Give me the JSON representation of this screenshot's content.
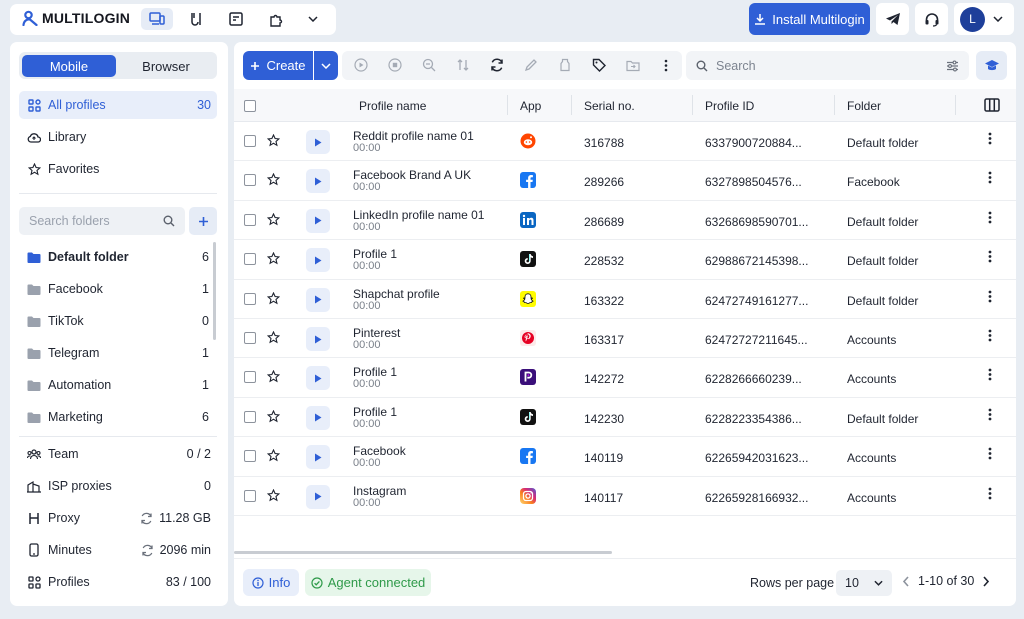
{
  "app": {
    "name": "MULTILOGIN"
  },
  "header": {
    "install_label": "Install Multilogin",
    "avatar_initial": "L",
    "nav_icons": [
      "devices-icon",
      "analytics-icon",
      "api-icon",
      "extension-icon",
      "chevron-down-icon"
    ]
  },
  "sidebar": {
    "tabs": {
      "mobile": "Mobile",
      "browser": "Browser"
    },
    "nav": [
      {
        "label": "All profiles",
        "count": "30",
        "icon": "grid-icon"
      },
      {
        "label": "Library",
        "count": "",
        "icon": "cloud-icon"
      },
      {
        "label": "Favorites",
        "count": "",
        "icon": "star-icon"
      }
    ],
    "folder_search_placeholder": "Search folders",
    "folders": [
      {
        "label": "Default folder",
        "count": "6"
      },
      {
        "label": "Facebook",
        "count": "1"
      },
      {
        "label": "TikTok",
        "count": "0"
      },
      {
        "label": "Telegram",
        "count": "1"
      },
      {
        "label": "Automation",
        "count": "1"
      },
      {
        "label": "Marketing",
        "count": "6"
      }
    ],
    "stats": [
      {
        "label": "Team",
        "value": "0 / 2"
      },
      {
        "label": "ISP proxies",
        "value": "0"
      },
      {
        "label": "Proxy",
        "value": "11.28 GB"
      },
      {
        "label": "Minutes",
        "value": "2096 min"
      },
      {
        "label": "Profiles",
        "value": "83 / 100"
      }
    ]
  },
  "toolbar": {
    "create_label": "Create",
    "search_placeholder": "Search"
  },
  "table": {
    "columns": [
      "Profile name",
      "App",
      "Serial no.",
      "Profile ID",
      "Folder"
    ],
    "rows": [
      {
        "name": "Reddit profile name 01",
        "time": "00:00",
        "app": "reddit",
        "serial": "316788",
        "id": "6337900720884...",
        "folder": "Default folder"
      },
      {
        "name": "Facebook Brand A UK",
        "time": "00:00",
        "app": "facebook",
        "serial": "289266",
        "id": "6327898504576...",
        "folder": "Facebook"
      },
      {
        "name": "LinkedIn profile name 01",
        "time": "00:00",
        "app": "linkedin",
        "serial": "286689",
        "id": "63268698590701...",
        "folder": "Default folder"
      },
      {
        "name": "Profile 1",
        "time": "00:00",
        "app": "tiktok",
        "serial": "228532",
        "id": "62988672145398...",
        "folder": "Default folder"
      },
      {
        "name": "Shapchat profile",
        "time": "00:00",
        "app": "snapchat",
        "serial": "163322",
        "id": "62472749161277...",
        "folder": "Default folder"
      },
      {
        "name": "Pinterest",
        "time": "00:00",
        "app": "pinterest",
        "serial": "163317",
        "id": "62472727211645...",
        "folder": "Accounts"
      },
      {
        "name": "Profile 1",
        "time": "00:00",
        "app": "picsart",
        "serial": "142272",
        "id": "6228266660239...",
        "folder": "Accounts"
      },
      {
        "name": "Profile 1",
        "time": "00:00",
        "app": "tiktok",
        "serial": "142230",
        "id": "6228223354386...",
        "folder": "Default folder"
      },
      {
        "name": "Facebook",
        "time": "00:00",
        "app": "facebook",
        "serial": "140119",
        "id": "62265942031623...",
        "folder": "Accounts"
      },
      {
        "name": "Instagram",
        "time": "00:00",
        "app": "instagram",
        "serial": "140117",
        "id": "62265928166932...",
        "folder": "Accounts"
      }
    ]
  },
  "footer": {
    "info_label": "Info",
    "agent_label": "Agent connected",
    "rows_per_page_label": "Rows per page",
    "rows_per_page_value": "10",
    "range_label": "1-10 of 30"
  },
  "colors": {
    "accent": "#2f5fd6",
    "success": "#2f9a4a"
  }
}
